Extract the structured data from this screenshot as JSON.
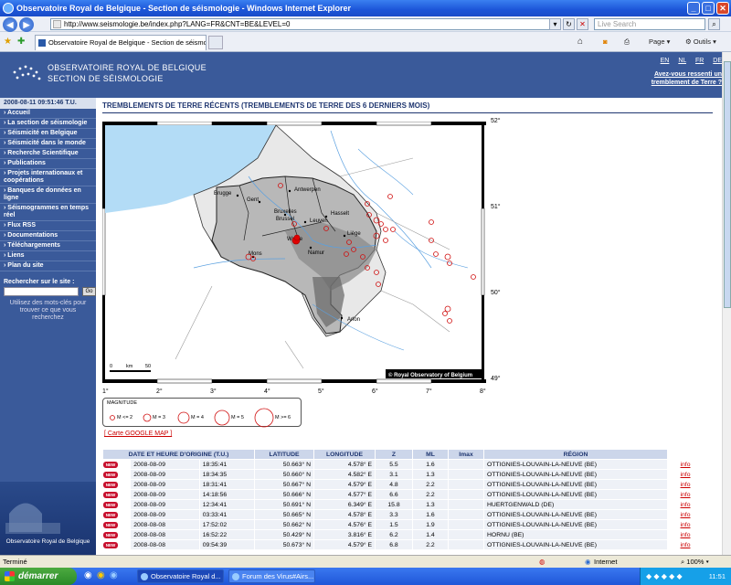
{
  "window": {
    "title": "Observatoire Royal de Belgique - Section de séismologie - Windows Internet Explorer"
  },
  "address_bar": {
    "url": "http://www.seismologie.be/index.php?LANG=FR&CNT=BE&LEVEL=0",
    "search_placeholder": "Live Search"
  },
  "tabs": [
    {
      "label": "Observatoire Royal de Belgique - Section de séismologie"
    }
  ],
  "toolbar": {
    "page_label": "Page",
    "tools_label": "Outils"
  },
  "header": {
    "logo_line1": "OBSERVATOIRE ROYAL DE BELGIQUE",
    "logo_line2": "SECTION DE SÉISMOLOGIE",
    "langs": [
      "EN",
      "NL",
      "FR",
      "DE"
    ],
    "felt_link": "Avez-vous ressenti un tremblement de Terre ?"
  },
  "sidebar": {
    "datetime": "2008-08-11  09:51:46 T.U.",
    "menu": [
      "Accueil",
      "La section de séismologie",
      "Séismicité en Belgique",
      "Séismicité dans le monde",
      "Recherche Scientifique",
      "Publications",
      "Projets internationaux et coopérations",
      "Banques de données en ligne",
      "Séismogrammes en temps réel",
      "Flux RSS",
      "Documentations",
      "Téléchargements",
      "Liens",
      "Plan du site"
    ],
    "search_label": "Rechercher sur le site :",
    "go_label": "Go",
    "search_hint": "Utilisez des mots-clés pour trouver ce que vous recherchez",
    "footer_caption": "Observatoire Royal de Belgique"
  },
  "main": {
    "title": "TREMBLEMENTS DE TERRE RÉCENTS (TREMBLEMENTS DE TERRE DES 6 DERNIERS MOIS)",
    "map": {
      "lon_labels": [
        "1°",
        "2°",
        "3°",
        "4°",
        "5°",
        "6°",
        "7°",
        "8°"
      ],
      "lat_labels": [
        "52°",
        "51°",
        "50°",
        "49°"
      ],
      "cities": [
        "Brugge",
        "Gent",
        "Antwerpen",
        "Bruxelles",
        "Brussel",
        "Leuven",
        "Hasselt",
        "Liège",
        "Wavre",
        "Namur",
        "Mons",
        "Arlon"
      ],
      "copyright": "© Royal Observatory of Belgium",
      "scale_labels": [
        "0",
        "km",
        "50"
      ]
    },
    "legend": {
      "title": "MAGNITUDE",
      "items": [
        "M <= 2",
        "M = 3",
        "M = 4",
        "M = 5",
        "M >= 6"
      ]
    },
    "google_link": "[ Carte GOOGLE MAP ]",
    "table": {
      "headers": [
        "DATE ET HEURE D'ORIGINE (T.U.)",
        "LATITUDE",
        "LONGITUDE",
        "Z",
        "ML",
        "Imax",
        "RÉGION"
      ],
      "new_label": "NEW",
      "info_label": "info",
      "rows": [
        [
          "2008-08-09",
          "18:35:41",
          "50.663° N",
          "4.578° E",
          "5.5",
          "1.6",
          "",
          "OTTIGNIES-LOUVAIN-LA-NEUVE (BE)"
        ],
        [
          "2008-08-09",
          "18:34:35",
          "50.660° N",
          "4.582° E",
          "3.1",
          "1.3",
          "",
          "OTTIGNIES-LOUVAIN-LA-NEUVE (BE)"
        ],
        [
          "2008-08-09",
          "18:31:41",
          "50.667° N",
          "4.579° E",
          "4.8",
          "2.2",
          "",
          "OTTIGNIES-LOUVAIN-LA-NEUVE (BE)"
        ],
        [
          "2008-08-09",
          "14:18:56",
          "50.666° N",
          "4.577° E",
          "6.6",
          "2.2",
          "",
          "OTTIGNIES-LOUVAIN-LA-NEUVE (BE)"
        ],
        [
          "2008-08-09",
          "12:34:41",
          "50.691° N",
          "6.349° E",
          "15.8",
          "1.3",
          "",
          "HUERTGENWALD (DE)"
        ],
        [
          "2008-08-09",
          "03:33:41",
          "50.665° N",
          "4.578° E",
          "3.3",
          "1.6",
          "",
          "OTTIGNIES-LOUVAIN-LA-NEUVE (BE)"
        ],
        [
          "2008-08-08",
          "17:52:02",
          "50.662° N",
          "4.576° E",
          "1.5",
          "1.9",
          "",
          "OTTIGNIES-LOUVAIN-LA-NEUVE (BE)"
        ],
        [
          "2008-08-08",
          "16:52:22",
          "50.429° N",
          "3.816° E",
          "6.2",
          "1.4",
          "",
          "HORNU (BE)"
        ],
        [
          "2008-08-08",
          "09:54:39",
          "50.673° N",
          "4.579° E",
          "6.8",
          "2.2",
          "",
          "OTTIGNIES-LOUVAIN-LA-NEUVE (BE)"
        ]
      ]
    }
  },
  "statusbar": {
    "status": "Terminé",
    "zone": "Internet",
    "zoom": "100%"
  },
  "taskbar": {
    "start_label": "démarrer",
    "tasks": [
      "Observatoire Royal d...",
      "Forum des Virus#Airs..."
    ],
    "clock": "11:51"
  }
}
